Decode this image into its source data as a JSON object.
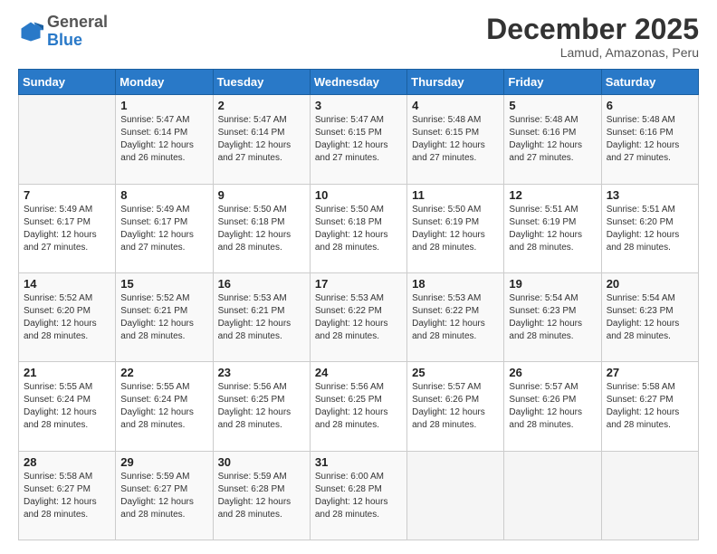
{
  "logo": {
    "general": "General",
    "blue": "Blue"
  },
  "header": {
    "month": "December 2025",
    "location": "Lamud, Amazonas, Peru"
  },
  "days_of_week": [
    "Sunday",
    "Monday",
    "Tuesday",
    "Wednesday",
    "Thursday",
    "Friday",
    "Saturday"
  ],
  "weeks": [
    [
      {
        "day": "",
        "info": ""
      },
      {
        "day": "1",
        "info": "Sunrise: 5:47 AM\nSunset: 6:14 PM\nDaylight: 12 hours\nand 26 minutes."
      },
      {
        "day": "2",
        "info": "Sunrise: 5:47 AM\nSunset: 6:14 PM\nDaylight: 12 hours\nand 27 minutes."
      },
      {
        "day": "3",
        "info": "Sunrise: 5:47 AM\nSunset: 6:15 PM\nDaylight: 12 hours\nand 27 minutes."
      },
      {
        "day": "4",
        "info": "Sunrise: 5:48 AM\nSunset: 6:15 PM\nDaylight: 12 hours\nand 27 minutes."
      },
      {
        "day": "5",
        "info": "Sunrise: 5:48 AM\nSunset: 6:16 PM\nDaylight: 12 hours\nand 27 minutes."
      },
      {
        "day": "6",
        "info": "Sunrise: 5:48 AM\nSunset: 6:16 PM\nDaylight: 12 hours\nand 27 minutes."
      }
    ],
    [
      {
        "day": "7",
        "info": "Sunrise: 5:49 AM\nSunset: 6:17 PM\nDaylight: 12 hours\nand 27 minutes."
      },
      {
        "day": "8",
        "info": "Sunrise: 5:49 AM\nSunset: 6:17 PM\nDaylight: 12 hours\nand 27 minutes."
      },
      {
        "day": "9",
        "info": "Sunrise: 5:50 AM\nSunset: 6:18 PM\nDaylight: 12 hours\nand 28 minutes."
      },
      {
        "day": "10",
        "info": "Sunrise: 5:50 AM\nSunset: 6:18 PM\nDaylight: 12 hours\nand 28 minutes."
      },
      {
        "day": "11",
        "info": "Sunrise: 5:50 AM\nSunset: 6:19 PM\nDaylight: 12 hours\nand 28 minutes."
      },
      {
        "day": "12",
        "info": "Sunrise: 5:51 AM\nSunset: 6:19 PM\nDaylight: 12 hours\nand 28 minutes."
      },
      {
        "day": "13",
        "info": "Sunrise: 5:51 AM\nSunset: 6:20 PM\nDaylight: 12 hours\nand 28 minutes."
      }
    ],
    [
      {
        "day": "14",
        "info": "Sunrise: 5:52 AM\nSunset: 6:20 PM\nDaylight: 12 hours\nand 28 minutes."
      },
      {
        "day": "15",
        "info": "Sunrise: 5:52 AM\nSunset: 6:21 PM\nDaylight: 12 hours\nand 28 minutes."
      },
      {
        "day": "16",
        "info": "Sunrise: 5:53 AM\nSunset: 6:21 PM\nDaylight: 12 hours\nand 28 minutes."
      },
      {
        "day": "17",
        "info": "Sunrise: 5:53 AM\nSunset: 6:22 PM\nDaylight: 12 hours\nand 28 minutes."
      },
      {
        "day": "18",
        "info": "Sunrise: 5:53 AM\nSunset: 6:22 PM\nDaylight: 12 hours\nand 28 minutes."
      },
      {
        "day": "19",
        "info": "Sunrise: 5:54 AM\nSunset: 6:23 PM\nDaylight: 12 hours\nand 28 minutes."
      },
      {
        "day": "20",
        "info": "Sunrise: 5:54 AM\nSunset: 6:23 PM\nDaylight: 12 hours\nand 28 minutes."
      }
    ],
    [
      {
        "day": "21",
        "info": "Sunrise: 5:55 AM\nSunset: 6:24 PM\nDaylight: 12 hours\nand 28 minutes."
      },
      {
        "day": "22",
        "info": "Sunrise: 5:55 AM\nSunset: 6:24 PM\nDaylight: 12 hours\nand 28 minutes."
      },
      {
        "day": "23",
        "info": "Sunrise: 5:56 AM\nSunset: 6:25 PM\nDaylight: 12 hours\nand 28 minutes."
      },
      {
        "day": "24",
        "info": "Sunrise: 5:56 AM\nSunset: 6:25 PM\nDaylight: 12 hours\nand 28 minutes."
      },
      {
        "day": "25",
        "info": "Sunrise: 5:57 AM\nSunset: 6:26 PM\nDaylight: 12 hours\nand 28 minutes."
      },
      {
        "day": "26",
        "info": "Sunrise: 5:57 AM\nSunset: 6:26 PM\nDaylight: 12 hours\nand 28 minutes."
      },
      {
        "day": "27",
        "info": "Sunrise: 5:58 AM\nSunset: 6:27 PM\nDaylight: 12 hours\nand 28 minutes."
      }
    ],
    [
      {
        "day": "28",
        "info": "Sunrise: 5:58 AM\nSunset: 6:27 PM\nDaylight: 12 hours\nand 28 minutes."
      },
      {
        "day": "29",
        "info": "Sunrise: 5:59 AM\nSunset: 6:27 PM\nDaylight: 12 hours\nand 28 minutes."
      },
      {
        "day": "30",
        "info": "Sunrise: 5:59 AM\nSunset: 6:28 PM\nDaylight: 12 hours\nand 28 minutes."
      },
      {
        "day": "31",
        "info": "Sunrise: 6:00 AM\nSunset: 6:28 PM\nDaylight: 12 hours\nand 28 minutes."
      },
      {
        "day": "",
        "info": ""
      },
      {
        "day": "",
        "info": ""
      },
      {
        "day": "",
        "info": ""
      }
    ]
  ]
}
